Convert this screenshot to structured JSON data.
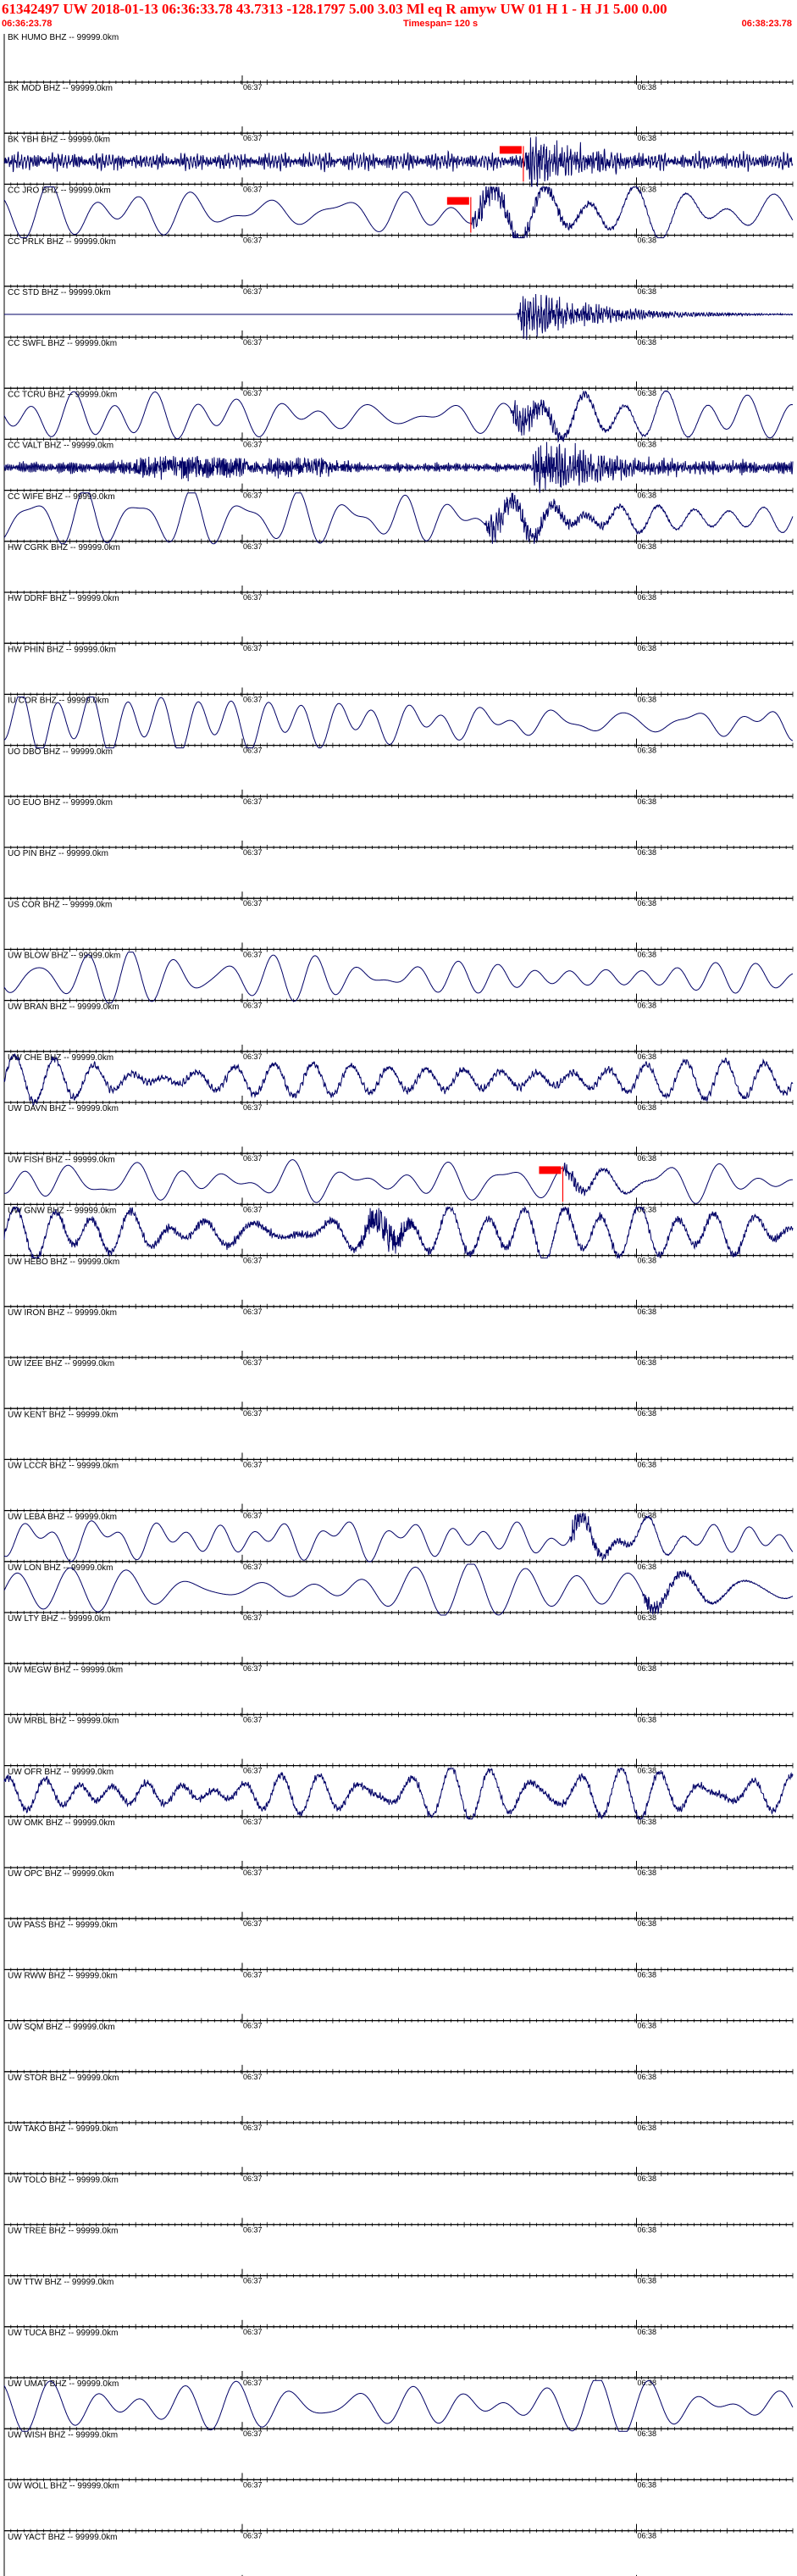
{
  "header": {
    "title": "61342497 UW 2018-01-13 06:36:33.78   43.7313 -128.1797   5.00  3.03 Ml  eq  R  amyw      UW 01  H   1  -  H J1    5.00  0.00",
    "start_time": "06:36:23.78",
    "timespan": "Timespan= 120 s",
    "end_time": "06:38:23.78"
  },
  "colors": {
    "trace": "#000066",
    "pick": "#ff0000",
    "header": "#ff0000",
    "axis": "#000000"
  },
  "chart_data": {
    "type": "line",
    "title": "61342497 UW 2018-01-13 06:36:33.78   43.7313 -128.1797   5.00  3.03 Ml  eq  R  amyw      UW 01  H   1  -  H J1    5.00  0.00",
    "xlim": [
      0,
      120
    ],
    "x_unit": "seconds after 06:36:23.78",
    "time_ticks": [
      {
        "t": 36.22,
        "label": "06:37"
      },
      {
        "t": 96.22,
        "label": "06:38"
      }
    ],
    "grid": false,
    "traces": [
      {
        "label": "BK HUMO BHZ -- 99999.0km",
        "kind": "flat"
      },
      {
        "label": "BK MOD BHZ -- 99999.0km",
        "kind": "flat"
      },
      {
        "label": "BK YBH BHZ -- 99999.0km",
        "kind": "hf",
        "amp": 0.45,
        "event": {
          "t": 79,
          "amp": 1.2,
          "dur": 18
        },
        "pick": {
          "t": 79
        }
      },
      {
        "label": "CC JRO BHZ -- 99999.0km",
        "kind": "lp",
        "amp": 0.85,
        "event": {
          "t": 71,
          "amp": 0.9,
          "dur": 20
        },
        "pick": {
          "t": 71
        }
      },
      {
        "label": "CC PRLK BHZ -- 99999.0km",
        "kind": "flat"
      },
      {
        "label": "CC STD BHZ -- 99999.0km",
        "kind": "flat",
        "event": {
          "t": 78,
          "amp": 1.3,
          "dur": 22
        }
      },
      {
        "label": "CC SWFL BHZ -- 99999.0km",
        "kind": "flat"
      },
      {
        "label": "CC TCRU BHZ -- 99999.0km",
        "kind": "lp",
        "amp": 0.85,
        "event": {
          "t": 77,
          "amp": 0.9,
          "dur": 14
        }
      },
      {
        "label": "CC VALT BHZ -- 99999.0km",
        "kind": "hf",
        "amp": 0.3,
        "bursts": [
          {
            "t": 28,
            "amp": 0.6,
            "dur": 26
          },
          {
            "t": 46,
            "amp": 0.5,
            "dur": 18
          }
        ],
        "event": {
          "t": 80,
          "amp": 1.4,
          "dur": 26
        }
      },
      {
        "label": "CC WIFE BHZ -- 99999.0km",
        "kind": "lp",
        "amp": 0.85,
        "event": {
          "t": 73,
          "amp": 0.8,
          "dur": 22
        }
      },
      {
        "label": "HW CGRK BHZ -- 99999.0km",
        "kind": "flat"
      },
      {
        "label": "HW DDRF BHZ -- 99999.0km",
        "kind": "flat"
      },
      {
        "label": "HW PHIN BHZ -- 99999.0km",
        "kind": "flat"
      },
      {
        "label": "IU COR BHZ -- 99999.0km",
        "kind": "lp",
        "amp": 0.85
      },
      {
        "label": "UO DBO BHZ -- 99999.0km",
        "kind": "flat"
      },
      {
        "label": "UO EUO BHZ -- 99999.0km",
        "kind": "flat"
      },
      {
        "label": "UO PIN BHZ -- 99999.0km",
        "kind": "flat"
      },
      {
        "label": "US COR BHZ -- 99999.0km",
        "kind": "flat"
      },
      {
        "label": "UW BLOW BHZ -- 99999.0km",
        "kind": "lp",
        "amp": 0.85
      },
      {
        "label": "UW BRAN BHZ -- 99999.0km",
        "kind": "flat"
      },
      {
        "label": "UW CHE BHZ -- 99999.0km",
        "kind": "mix",
        "amp": 0.8
      },
      {
        "label": "UW DAVN BHZ -- 99999.0km",
        "kind": "flat"
      },
      {
        "label": "UW FISH BHZ -- 99999.0km",
        "kind": "lp",
        "amp": 0.85,
        "event": {
          "t": 85,
          "amp": 0.5,
          "dur": 8
        },
        "pick": {
          "t": 85
        }
      },
      {
        "label": "UW GNW BHZ -- 99999.0km",
        "kind": "mix",
        "amp": 0.85,
        "bursts": [
          {
            "t": 58,
            "amp": 0.9,
            "dur": 10
          }
        ]
      },
      {
        "label": "UW HEBO BHZ -- 99999.0km",
        "kind": "flat"
      },
      {
        "label": "UW IRON BHZ -- 99999.0km",
        "kind": "flat"
      },
      {
        "label": "UW IZEE BHZ -- 99999.0km",
        "kind": "flat"
      },
      {
        "label": "UW KENT BHZ -- 99999.0km",
        "kind": "flat"
      },
      {
        "label": "UW LCCR BHZ -- 99999.0km",
        "kind": "flat"
      },
      {
        "label": "UW LEBA BHZ -- 99999.0km",
        "kind": "lp",
        "amp": 0.7,
        "event": {
          "t": 86,
          "amp": 0.7,
          "dur": 10
        }
      },
      {
        "label": "UW LON BHZ -- 99999.0km",
        "kind": "lp",
        "amp": 0.85,
        "event": {
          "t": 97,
          "amp": 0.5,
          "dur": 12
        }
      },
      {
        "label": "UW LTY BHZ -- 99999.0km",
        "kind": "flat"
      },
      {
        "label": "UW MEGW BHZ -- 99999.0km",
        "kind": "flat"
      },
      {
        "label": "UW MRBL BHZ -- 99999.0km",
        "kind": "flat"
      },
      {
        "label": "UW OFR BHZ -- 99999.0km",
        "kind": "mix",
        "amp": 0.75
      },
      {
        "label": "UW OMK BHZ -- 99999.0km",
        "kind": "flat"
      },
      {
        "label": "UW OPC BHZ -- 99999.0km",
        "kind": "flat"
      },
      {
        "label": "UW PASS BHZ -- 99999.0km",
        "kind": "flat"
      },
      {
        "label": "UW RWW BHZ -- 99999.0km",
        "kind": "flat"
      },
      {
        "label": "UW SQM BHZ -- 99999.0km",
        "kind": "flat"
      },
      {
        "label": "UW STOR BHZ -- 99999.0km",
        "kind": "flat"
      },
      {
        "label": "UW TAKO BHZ -- 99999.0km",
        "kind": "flat"
      },
      {
        "label": "UW TOLO BHZ -- 99999.0km",
        "kind": "flat"
      },
      {
        "label": "UW TREE BHZ -- 99999.0km",
        "kind": "flat"
      },
      {
        "label": "UW TTW BHZ -- 99999.0km",
        "kind": "flat"
      },
      {
        "label": "UW TUCA BHZ -- 99999.0km",
        "kind": "flat"
      },
      {
        "label": "UW UMAT BHZ -- 99999.0km",
        "kind": "lp",
        "amp": 0.8
      },
      {
        "label": "UW WISH BHZ -- 99999.0km",
        "kind": "flat"
      },
      {
        "label": "UW WOLL BHZ -- 99999.0km",
        "kind": "flat"
      },
      {
        "label": "UW YACT BHZ -- 99999.0km",
        "kind": "flat"
      }
    ]
  }
}
